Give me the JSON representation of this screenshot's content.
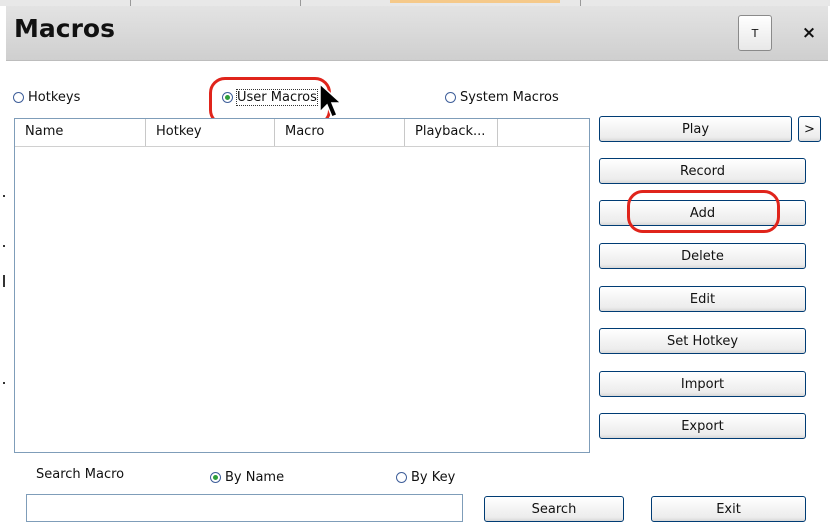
{
  "window": {
    "title": "Macros",
    "pin_label": "T",
    "close_label": "×"
  },
  "mode_radios": {
    "hotkeys": {
      "label": "Hotkeys",
      "selected": false
    },
    "user_macros": {
      "label": "User Macros",
      "selected": true
    },
    "system_macros": {
      "label": "System Macros",
      "selected": false
    }
  },
  "table": {
    "columns": [
      "Name",
      "Hotkey",
      "Macro",
      "Playback..."
    ],
    "rows": []
  },
  "buttons": {
    "play": "Play",
    "play_more": ">",
    "record": "Record",
    "add": "Add",
    "delete": "Delete",
    "edit": "Edit",
    "set_hotkey": "Set Hotkey",
    "import": "Import",
    "export": "Export",
    "search": "Search",
    "exit": "Exit"
  },
  "search": {
    "label": "Search Macro",
    "by_name": {
      "label": "By Name",
      "selected": true
    },
    "by_key": {
      "label": "By Key",
      "selected": false
    },
    "value": ""
  },
  "colors": {
    "highlight": "#e0241b",
    "radio_selected": "#2e9e3a",
    "border_blue": "#7f9db9"
  }
}
